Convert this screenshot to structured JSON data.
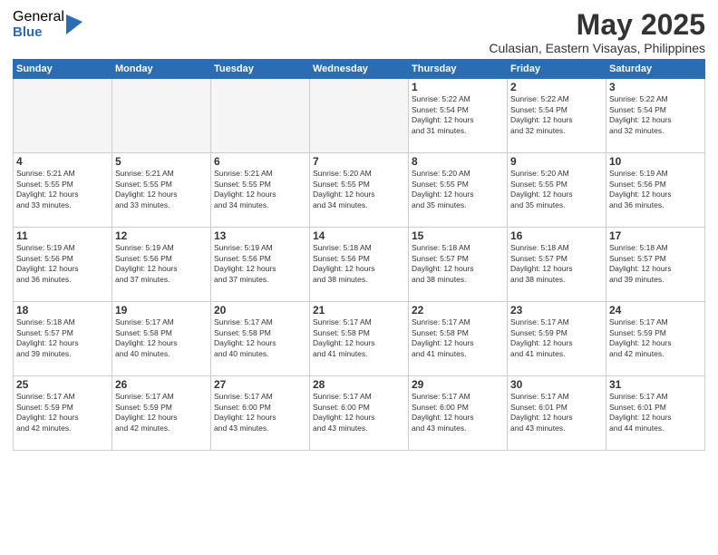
{
  "logo": {
    "general": "General",
    "blue": "Blue"
  },
  "title": "May 2025",
  "location": "Culasian, Eastern Visayas, Philippines",
  "weekdays": [
    "Sunday",
    "Monday",
    "Tuesday",
    "Wednesday",
    "Thursday",
    "Friday",
    "Saturday"
  ],
  "weeks": [
    [
      {
        "day": "",
        "info": ""
      },
      {
        "day": "",
        "info": ""
      },
      {
        "day": "",
        "info": ""
      },
      {
        "day": "",
        "info": ""
      },
      {
        "day": "1",
        "info": "Sunrise: 5:22 AM\nSunset: 5:54 PM\nDaylight: 12 hours\nand 31 minutes."
      },
      {
        "day": "2",
        "info": "Sunrise: 5:22 AM\nSunset: 5:54 PM\nDaylight: 12 hours\nand 32 minutes."
      },
      {
        "day": "3",
        "info": "Sunrise: 5:22 AM\nSunset: 5:54 PM\nDaylight: 12 hours\nand 32 minutes."
      }
    ],
    [
      {
        "day": "4",
        "info": "Sunrise: 5:21 AM\nSunset: 5:55 PM\nDaylight: 12 hours\nand 33 minutes."
      },
      {
        "day": "5",
        "info": "Sunrise: 5:21 AM\nSunset: 5:55 PM\nDaylight: 12 hours\nand 33 minutes."
      },
      {
        "day": "6",
        "info": "Sunrise: 5:21 AM\nSunset: 5:55 PM\nDaylight: 12 hours\nand 34 minutes."
      },
      {
        "day": "7",
        "info": "Sunrise: 5:20 AM\nSunset: 5:55 PM\nDaylight: 12 hours\nand 34 minutes."
      },
      {
        "day": "8",
        "info": "Sunrise: 5:20 AM\nSunset: 5:55 PM\nDaylight: 12 hours\nand 35 minutes."
      },
      {
        "day": "9",
        "info": "Sunrise: 5:20 AM\nSunset: 5:55 PM\nDaylight: 12 hours\nand 35 minutes."
      },
      {
        "day": "10",
        "info": "Sunrise: 5:19 AM\nSunset: 5:56 PM\nDaylight: 12 hours\nand 36 minutes."
      }
    ],
    [
      {
        "day": "11",
        "info": "Sunrise: 5:19 AM\nSunset: 5:56 PM\nDaylight: 12 hours\nand 36 minutes."
      },
      {
        "day": "12",
        "info": "Sunrise: 5:19 AM\nSunset: 5:56 PM\nDaylight: 12 hours\nand 37 minutes."
      },
      {
        "day": "13",
        "info": "Sunrise: 5:19 AM\nSunset: 5:56 PM\nDaylight: 12 hours\nand 37 minutes."
      },
      {
        "day": "14",
        "info": "Sunrise: 5:18 AM\nSunset: 5:56 PM\nDaylight: 12 hours\nand 38 minutes."
      },
      {
        "day": "15",
        "info": "Sunrise: 5:18 AM\nSunset: 5:57 PM\nDaylight: 12 hours\nand 38 minutes."
      },
      {
        "day": "16",
        "info": "Sunrise: 5:18 AM\nSunset: 5:57 PM\nDaylight: 12 hours\nand 38 minutes."
      },
      {
        "day": "17",
        "info": "Sunrise: 5:18 AM\nSunset: 5:57 PM\nDaylight: 12 hours\nand 39 minutes."
      }
    ],
    [
      {
        "day": "18",
        "info": "Sunrise: 5:18 AM\nSunset: 5:57 PM\nDaylight: 12 hours\nand 39 minutes."
      },
      {
        "day": "19",
        "info": "Sunrise: 5:17 AM\nSunset: 5:58 PM\nDaylight: 12 hours\nand 40 minutes."
      },
      {
        "day": "20",
        "info": "Sunrise: 5:17 AM\nSunset: 5:58 PM\nDaylight: 12 hours\nand 40 minutes."
      },
      {
        "day": "21",
        "info": "Sunrise: 5:17 AM\nSunset: 5:58 PM\nDaylight: 12 hours\nand 41 minutes."
      },
      {
        "day": "22",
        "info": "Sunrise: 5:17 AM\nSunset: 5:58 PM\nDaylight: 12 hours\nand 41 minutes."
      },
      {
        "day": "23",
        "info": "Sunrise: 5:17 AM\nSunset: 5:59 PM\nDaylight: 12 hours\nand 41 minutes."
      },
      {
        "day": "24",
        "info": "Sunrise: 5:17 AM\nSunset: 5:59 PM\nDaylight: 12 hours\nand 42 minutes."
      }
    ],
    [
      {
        "day": "25",
        "info": "Sunrise: 5:17 AM\nSunset: 5:59 PM\nDaylight: 12 hours\nand 42 minutes."
      },
      {
        "day": "26",
        "info": "Sunrise: 5:17 AM\nSunset: 5:59 PM\nDaylight: 12 hours\nand 42 minutes."
      },
      {
        "day": "27",
        "info": "Sunrise: 5:17 AM\nSunset: 6:00 PM\nDaylight: 12 hours\nand 43 minutes."
      },
      {
        "day": "28",
        "info": "Sunrise: 5:17 AM\nSunset: 6:00 PM\nDaylight: 12 hours\nand 43 minutes."
      },
      {
        "day": "29",
        "info": "Sunrise: 5:17 AM\nSunset: 6:00 PM\nDaylight: 12 hours\nand 43 minutes."
      },
      {
        "day": "30",
        "info": "Sunrise: 5:17 AM\nSunset: 6:01 PM\nDaylight: 12 hours\nand 43 minutes."
      },
      {
        "day": "31",
        "info": "Sunrise: 5:17 AM\nSunset: 6:01 PM\nDaylight: 12 hours\nand 44 minutes."
      }
    ]
  ]
}
